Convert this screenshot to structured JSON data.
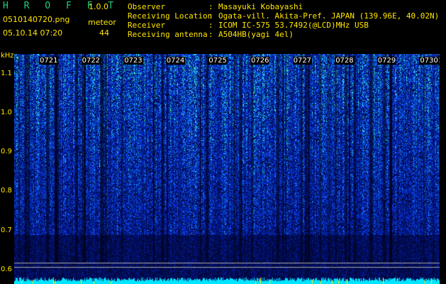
{
  "header": {
    "app_title": "H R O F F T",
    "version": "1.0.0",
    "filename": "0510140720.png",
    "meteor_label": "meteor",
    "datetime": "05.10.14 07:20",
    "meteor_count": "44",
    "info": [
      {
        "key": "Observer",
        "sep": ":",
        "value": "Masayuki Kobayashi"
      },
      {
        "key": "Receiving Location",
        "sep": ":",
        "value": "Ogata-vill. Akita-Pref. JAPAN (139.96E, 40.02N)"
      },
      {
        "key": "Receiver",
        "sep": ":",
        "value": "ICOM IC-575 53.7492(@LCD)MHz USB"
      },
      {
        "key": "Receiving antenna",
        "sep": ":",
        "value": "A504HB(yagi 4el)"
      }
    ]
  },
  "axis": {
    "unit": "kHz",
    "yticks": [
      "1.1",
      "1.0",
      "0.9",
      "0.8",
      "0.7",
      "0.6"
    ],
    "ymin": 0.6,
    "ymax": 1.15
  },
  "time_labels": [
    "0721",
    "0722",
    "0723",
    "0724",
    "0725",
    "0726",
    "0727",
    "0728",
    "0729",
    "0730"
  ],
  "colors": {
    "background": "#000000",
    "text_yellow": "#ffe600",
    "title_green": "#1fd07a",
    "spectrum_dark": "#001a66",
    "spectrum_mid": "#0033cc",
    "spectrum_hot": "#33ffcc",
    "baseline": "#00e5ff"
  }
}
